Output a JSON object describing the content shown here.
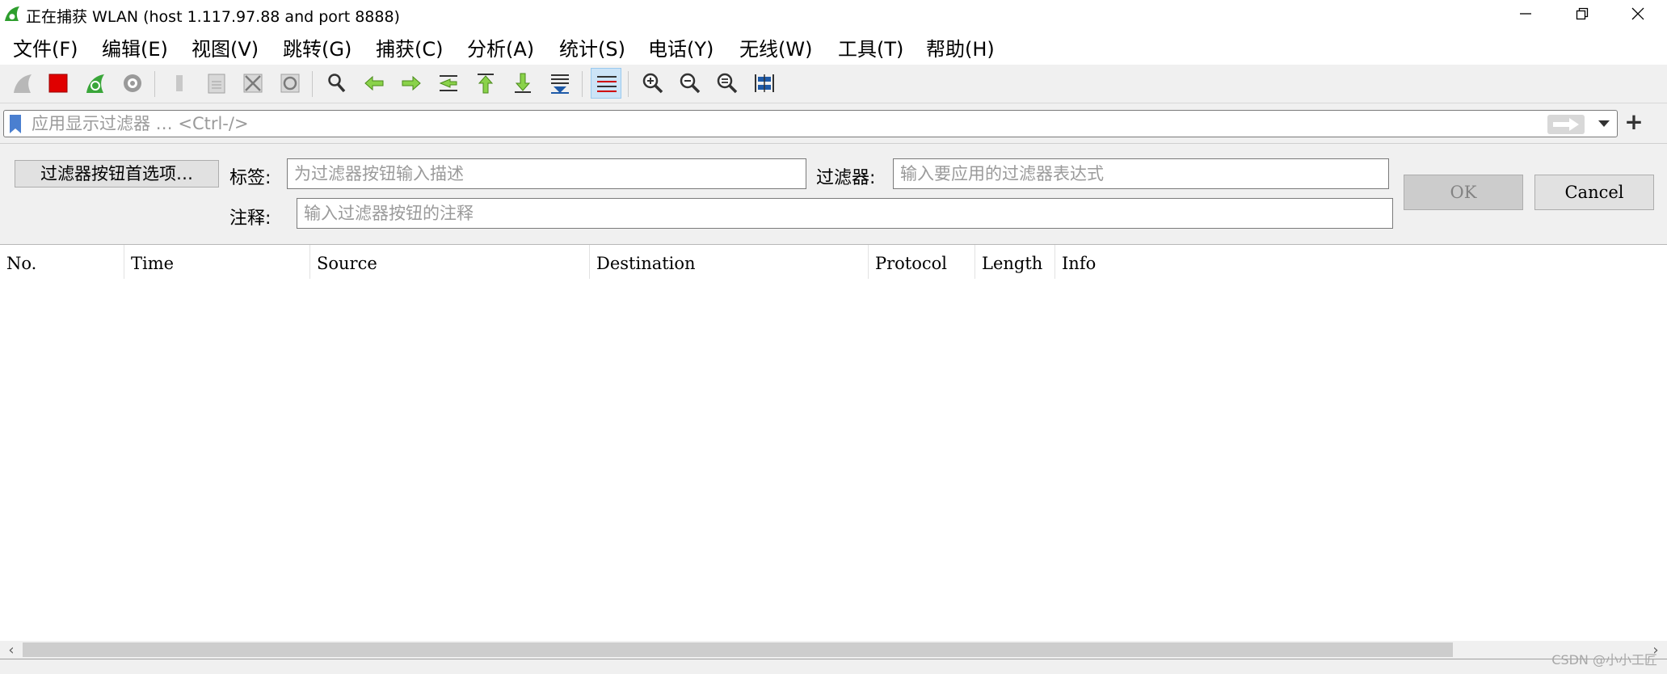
{
  "window": {
    "title": "正在捕获 WLAN (host 1.117.97.88 and port 8888)",
    "minimize_icon": "minimize-icon",
    "restore_icon": "restore-icon",
    "close_icon": "close-icon"
  },
  "menu": {
    "items": [
      "文件(F)",
      "编辑(E)",
      "视图(V)",
      "跳转(G)",
      "捕获(C)",
      "分析(A)",
      "统计(S)",
      "电话(Y)",
      "无线(W)",
      "工具(T)",
      "帮助(H)"
    ]
  },
  "toolbar": {
    "icons": [
      "start-capture-icon",
      "stop-capture-icon",
      "restart-capture-icon",
      "capture-options-icon",
      "open-file-icon",
      "save-file-icon",
      "close-file-icon",
      "reload-file-icon",
      "find-packet-icon",
      "go-back-icon",
      "go-forward-icon",
      "go-to-packet-icon",
      "first-packet-icon",
      "last-packet-icon",
      "auto-scroll-icon",
      "colorize-icon",
      "zoom-in-icon",
      "zoom-out-icon",
      "normal-size-icon",
      "resize-columns-icon"
    ],
    "active": "colorize-icon"
  },
  "display_filter": {
    "placeholder": "应用显示过滤器 … <Ctrl-/>",
    "value": ""
  },
  "filter_button_editor": {
    "prefs_button": "过滤器按钮首选项…",
    "label_caption": "标签:",
    "label_placeholder": "为过滤器按钮输入描述",
    "filter_caption": "过滤器:",
    "filter_placeholder": "输入要应用的过滤器表达式",
    "comment_caption": "注释:",
    "comment_placeholder": "输入过滤器按钮的注释",
    "ok_label": "OK",
    "cancel_label": "Cancel"
  },
  "packet_list": {
    "columns": [
      "No.",
      "Time",
      "Source",
      "Destination",
      "Protocol",
      "Length",
      "Info"
    ],
    "rows": []
  },
  "watermark": "CSDN @小小工匠",
  "colors": {
    "toolbar_bg": "#f0f0f0",
    "stop_red": "#e00000",
    "shark_green": "#3aa63a",
    "arrow_green": "#2e9e2e",
    "active_highlight": "#cce4f7"
  }
}
